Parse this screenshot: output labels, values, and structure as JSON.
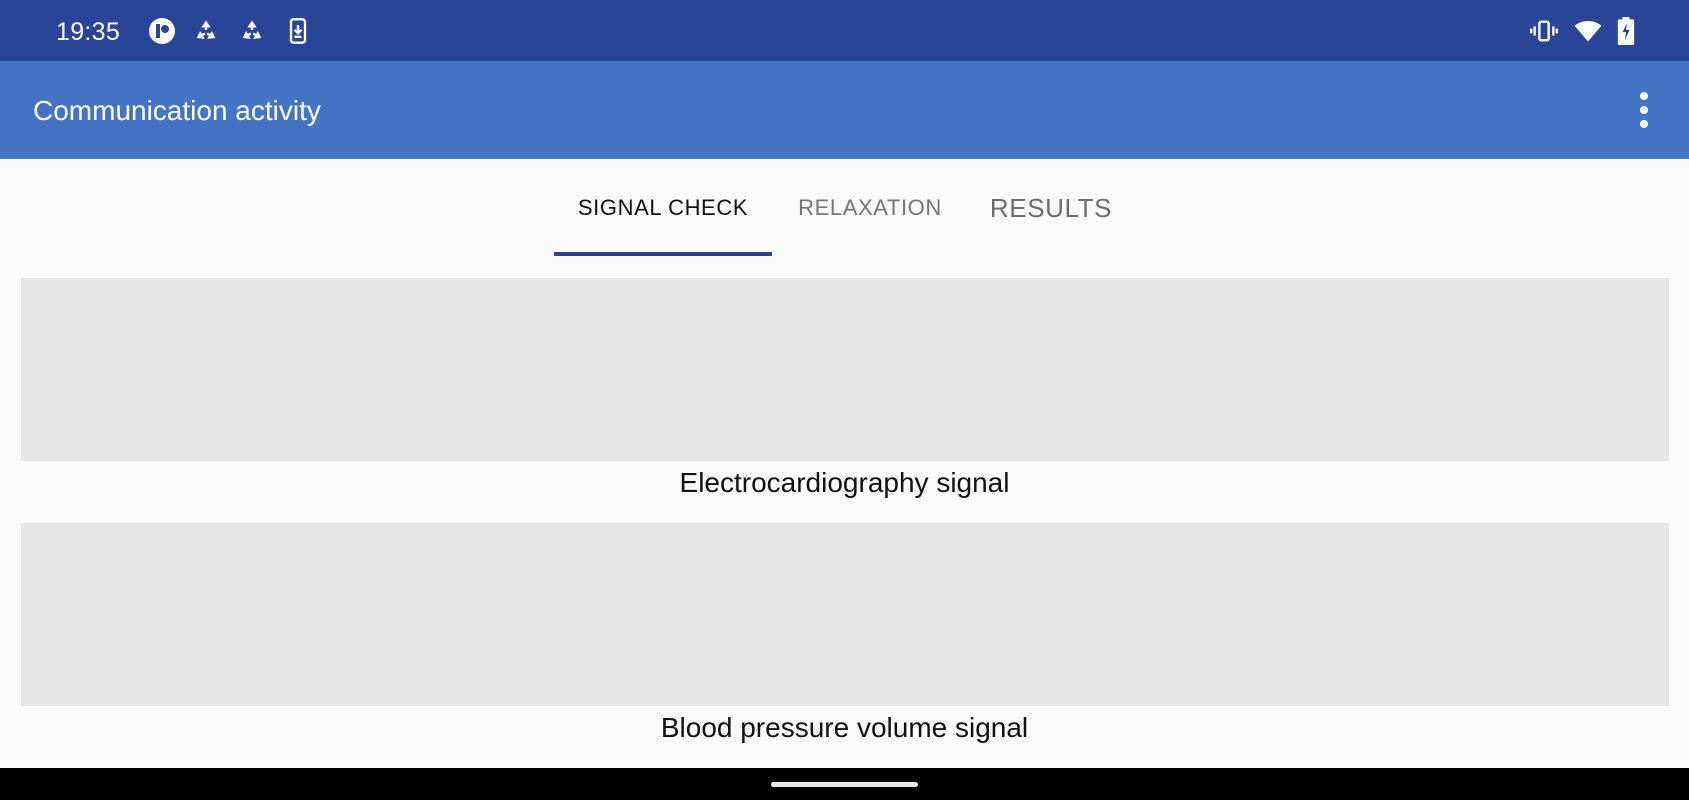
{
  "status_bar": {
    "time": "19:35",
    "icons_left": [
      "p-circle-icon",
      "recycle-icon",
      "recycle-icon",
      "download-icon"
    ],
    "icons_right": [
      "vibrate-icon",
      "wifi-icon",
      "battery-charging-icon"
    ],
    "background": "#2a4597"
  },
  "app_bar": {
    "title": "Communication activity",
    "background": "#4574c4",
    "menu_icon": "more-vert-icon"
  },
  "tabs": [
    {
      "label": "SIGNAL CHECK",
      "selected": true
    },
    {
      "label": "RELAXATION",
      "selected": false
    },
    {
      "label": "RESULTS",
      "selected": false
    }
  ],
  "tab_indicator_color": "#2a3f9c",
  "signals": [
    {
      "caption": "Electrocardiography signal"
    },
    {
      "caption": "Blood pressure volume signal"
    }
  ],
  "nav_bar": {
    "handle": "home-gesture-handle"
  }
}
